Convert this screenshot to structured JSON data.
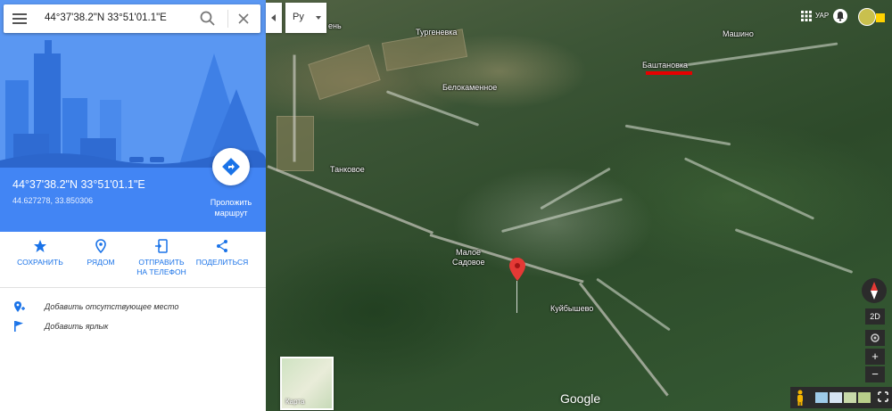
{
  "search": {
    "value": "44°37'38.2\"N 33°51'01.1\"E"
  },
  "place_card": {
    "coords_dms": "44°37'38.2\"N 33°51'01.1\"E",
    "coords_decimal": "44.627278, 33.850306",
    "route_label_1": "Проложить",
    "route_label_2": "маршрут"
  },
  "actions": [
    {
      "label_1": "СОХРАНИТЬ",
      "label_2": "",
      "icon": "star-icon"
    },
    {
      "label_1": "РЯДОМ",
      "label_2": "",
      "icon": "nearby-pin-icon"
    },
    {
      "label_1": "ОТПРАВИТЬ",
      "label_2": "НА ТЕЛЕФОН",
      "icon": "send-to-phone-icon"
    },
    {
      "label_1": "ПОДЕЛИТЬСЯ",
      "label_2": "",
      "icon": "share-icon"
    }
  ],
  "list_items": [
    {
      "label": "Добавить отсутствующее место",
      "icon": "add-place-icon"
    },
    {
      "label": "Добавить ярлык",
      "icon": "flag-icon"
    }
  ],
  "language": {
    "label": "Ру"
  },
  "account": {
    "label": "УАР"
  },
  "map": {
    "places": [
      "Тургеневка",
      "Белокаменное",
      "Танковое",
      "Малое",
      "Садовое",
      "Куйбышево",
      "Баштановка",
      "Машино",
      "ень"
    ],
    "thumbnail_label": "Карта",
    "attribution": "Google",
    "controls": {
      "view_mode": "2D",
      "zoom_in": "+",
      "zoom_out": "−"
    },
    "colors": {
      "annotation": "#e60000",
      "pin": "#e53935",
      "accent": "#4285f4"
    }
  }
}
